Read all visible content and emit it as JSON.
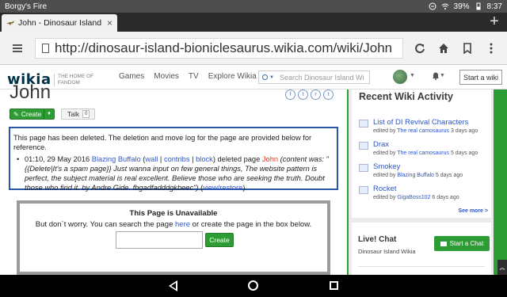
{
  "status_bar": {
    "app_label": "Borgy's Fire",
    "battery": "39%",
    "time": "8:37"
  },
  "tab": {
    "title": "John - Dinosaur Island Bi",
    "close": "×"
  },
  "new_tab_label": "+",
  "address_bar": {
    "url": "http://dinosaur-island-bioniclesaurus.wikia.com/wiki/John"
  },
  "wikia_nav": {
    "logo": "wikia",
    "tagline_1": "THE HOME OF",
    "tagline_2": "FANDOM",
    "links": [
      "Games",
      "Movies",
      "TV",
      "Explore Wikia"
    ],
    "search_placeholder": "Search Dinosaur Island Wi",
    "start_wiki": "Start a wiki"
  },
  "article": {
    "title": "John",
    "create_label": "Create",
    "talk_label": "Talk",
    "talk_count": "0",
    "notice_intro": "This page has been deleted. The deletion and move log for the page are provided below for reference.",
    "log": {
      "timestamp": "01:10, 29 May 2016",
      "user": "Blazing Buffalo",
      "wall": "wall",
      "contribs": "contribs",
      "block": "block",
      "action": "deleted page",
      "page": "John",
      "content_prefix": "(content was: \"{{Delete|It's a spam page}} Just wanna input on few general things, The website pattern is perfect, the subject material is real excellent. Believe those who are seeking the truth. Doubt those who find it. by Andre Gide. fbgadfadddgkbeec\")",
      "view_restore": "view/restore"
    },
    "unavailable_title": "This Page is Unavailable",
    "unavailable_msg_1": "But don`t worry. You can search the page ",
    "unavailable_link": "here",
    "unavailable_msg_2": " or create the page in the box below.",
    "create_button": "Create"
  },
  "recent_activity": {
    "title": "Recent Wiki Activity",
    "items": [
      {
        "name": "List of DI Revival Characters",
        "by": "The real camosaurus",
        "when": "3 days ago"
      },
      {
        "name": "Drax",
        "by": "The real camosaurus",
        "when": "5 days ago"
      },
      {
        "name": "Smokey",
        "by": "Blazing Buffalo",
        "when": "5 days ago"
      },
      {
        "name": "Rocket",
        "by": "GigaBoss102",
        "when": "6 days ago"
      }
    ],
    "edited_by": "edited by",
    "see_more": "See more >"
  },
  "live_chat": {
    "title": "Live! Chat",
    "subtitle": "Dinosaur Island Wikia",
    "button": "Start a Chat"
  },
  "colors": {
    "accent_green": "#2e9c35",
    "link_blue": "#2f56c5",
    "notice_border": "#2b55a5",
    "redlink": "#d43c1f"
  }
}
